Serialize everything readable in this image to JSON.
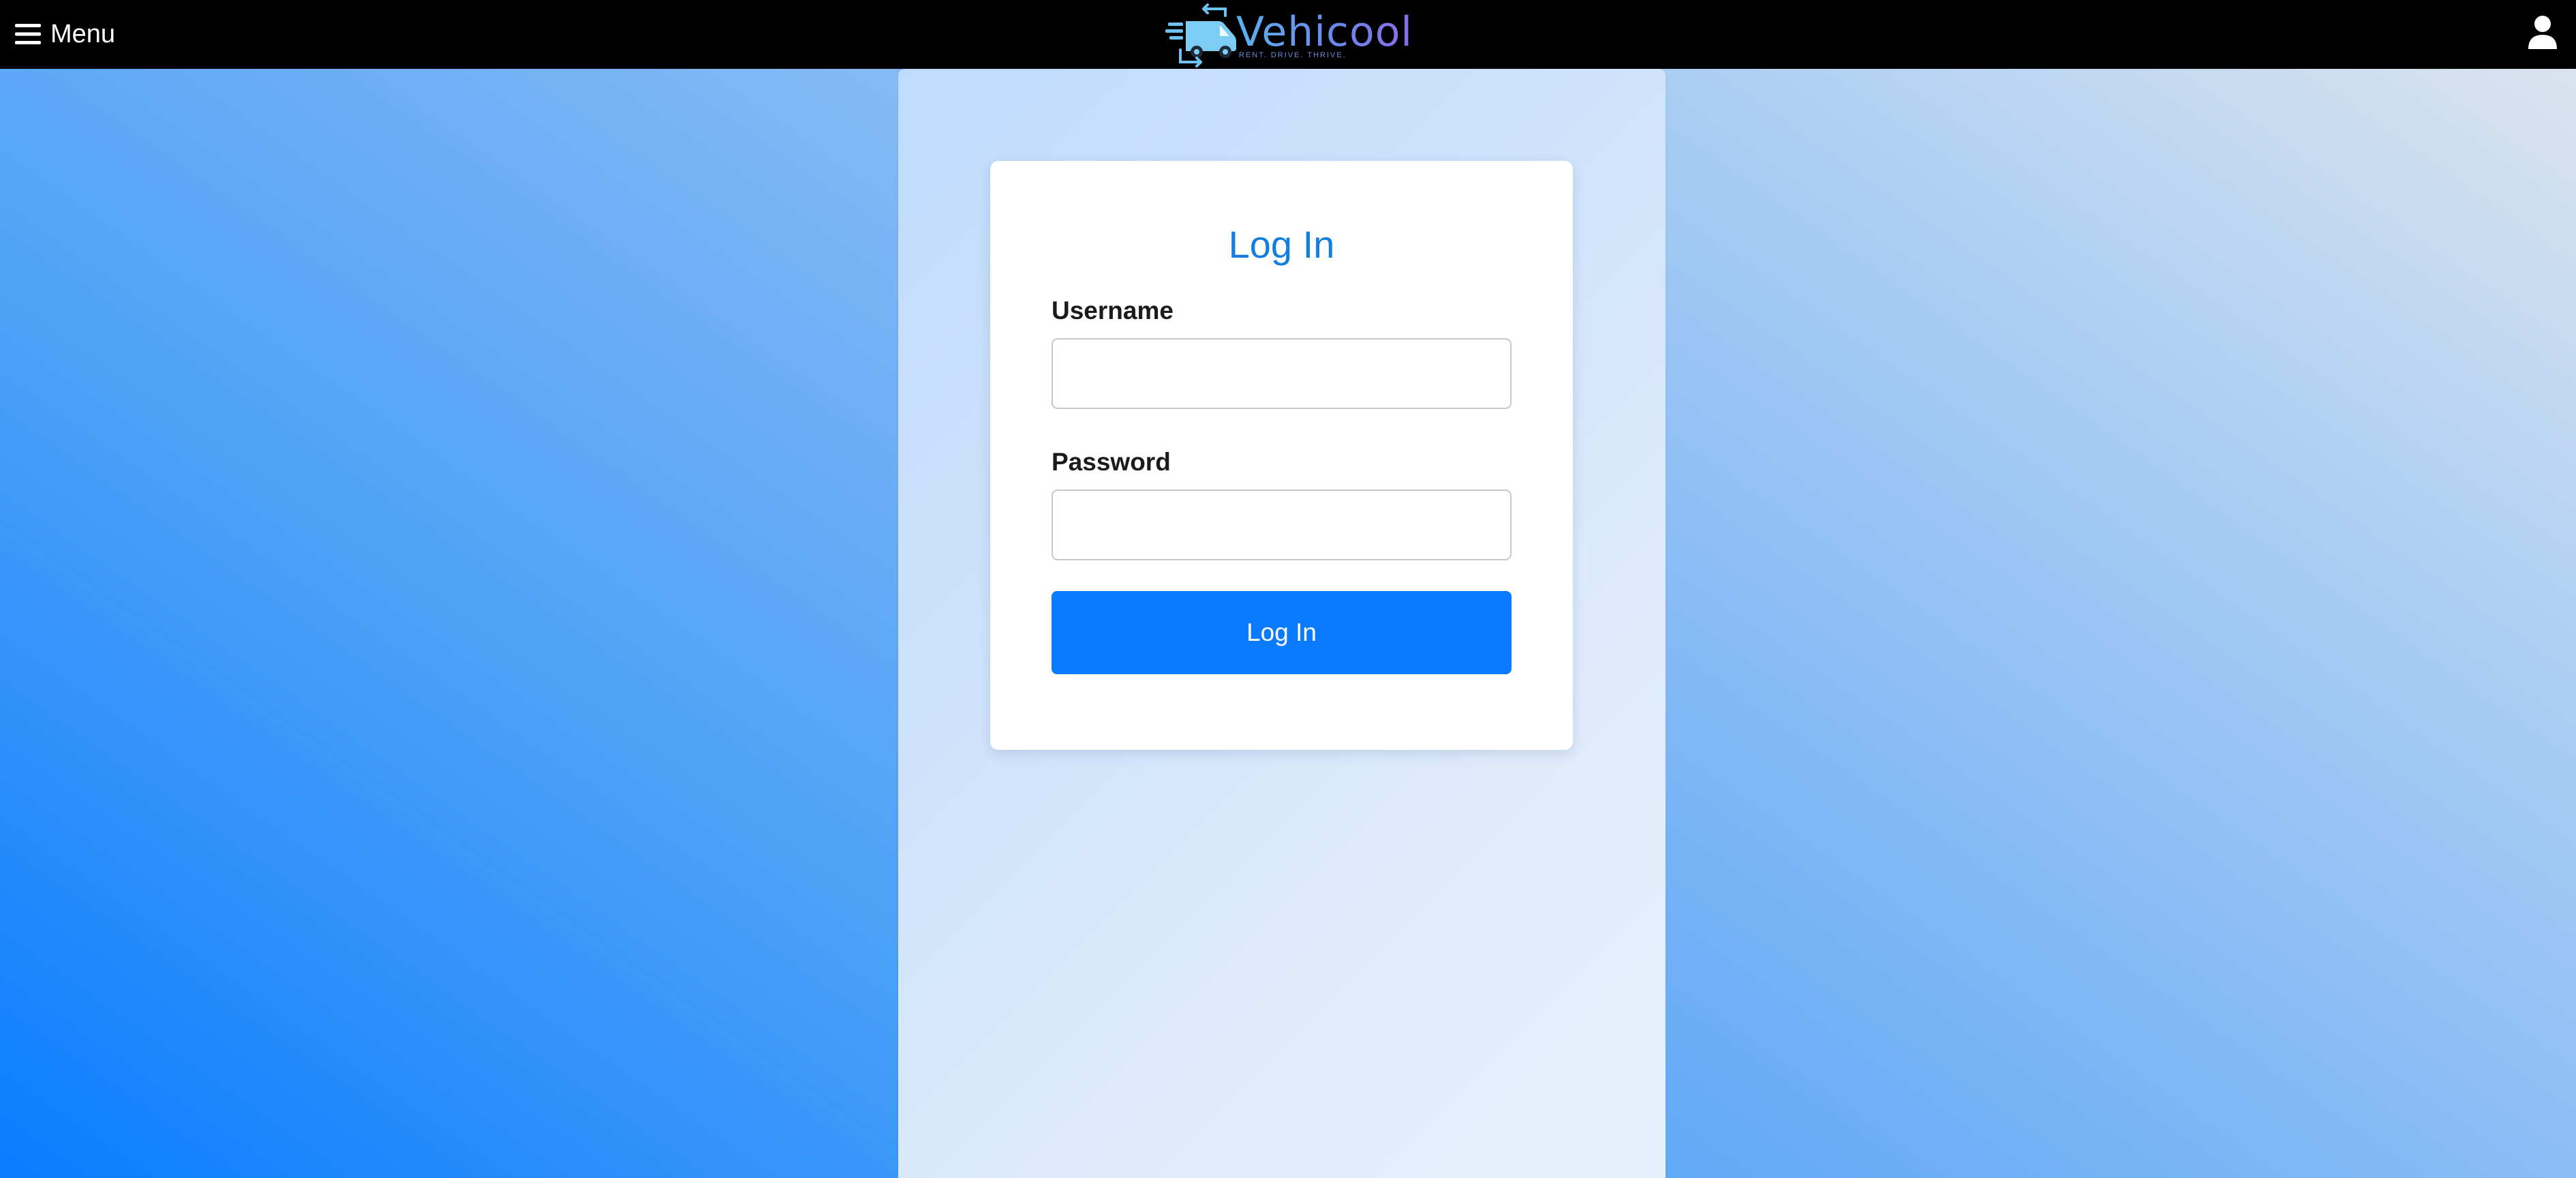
{
  "navbar": {
    "menu_label": "Menu",
    "menu_icon": "hamburger-icon",
    "brand_name": "Vehicool",
    "brand_tagline": "RENT. DRIVE. THRIVE.",
    "brand_icon": "van-with-arrows-icon",
    "user_icon": "user-icon"
  },
  "login": {
    "title": "Log In",
    "username_label": "Username",
    "username_value": "",
    "password_label": "Password",
    "password_value": "",
    "submit_label": "Log In"
  },
  "colors": {
    "navbar_bg": "#000000",
    "accent": "#0a7bff",
    "title": "#137ee0",
    "brand_start": "#5ab2ee",
    "brand_end": "#8a6de8"
  }
}
